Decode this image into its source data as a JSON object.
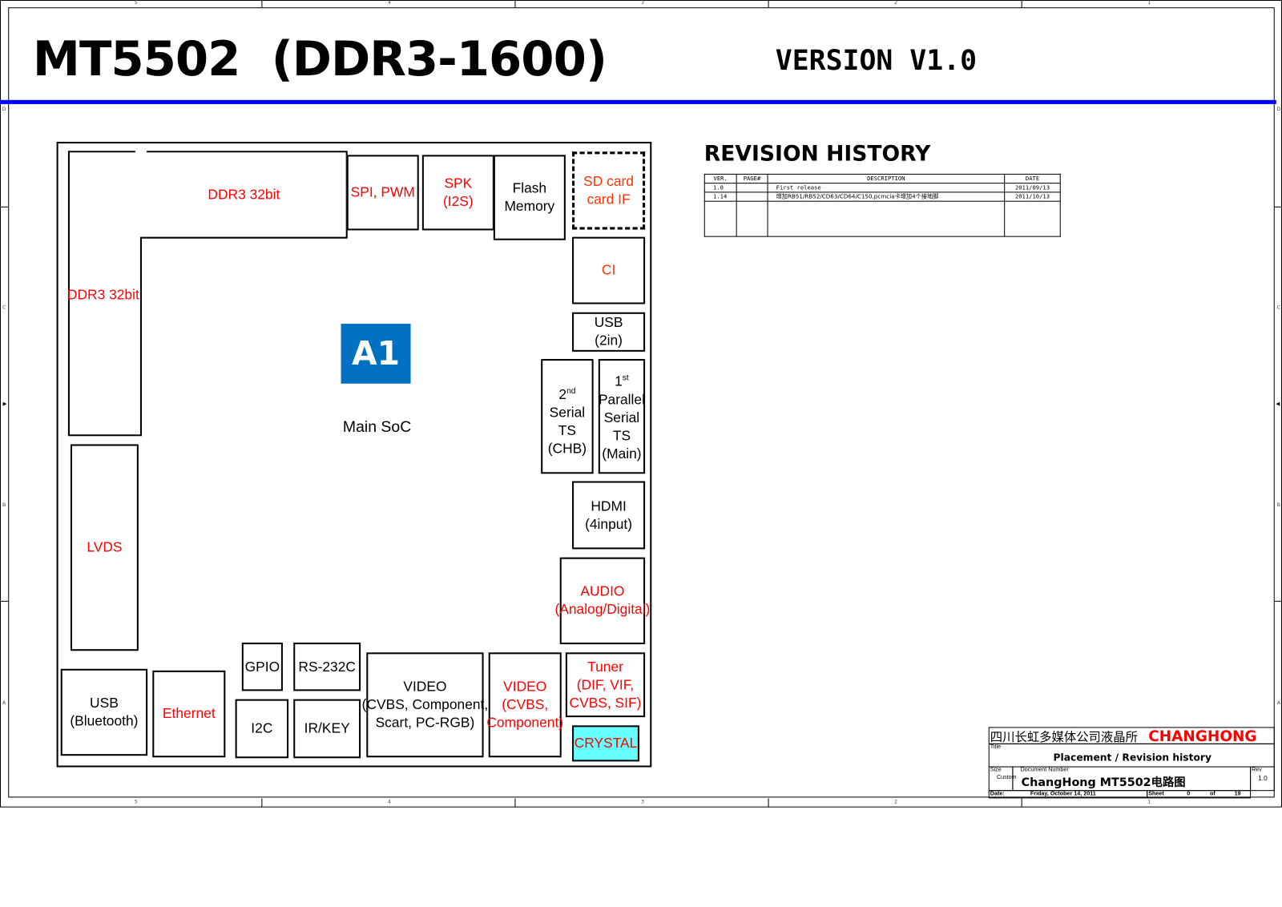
{
  "header": {
    "title": "MT5502  (DDR3-1600)",
    "version": "VERSION V1.0",
    "accent_color": "#0000ff"
  },
  "zones": {
    "columns": [
      "5",
      "4",
      "3",
      "2",
      "1"
    ],
    "rows": [
      "D",
      "C",
      "B",
      "A"
    ]
  },
  "block_diagram": {
    "soc_badge": "A1",
    "soc_badge_color": "#0070c0",
    "soc_label": "Main SoC",
    "blocks": {
      "ddr3_top": "DDR3 32bit",
      "ddr3_left": "DDR3 32bit",
      "spi_pwm": "SPI, PWM",
      "spk_line1": "SPK",
      "spk_line2": "(I2S)",
      "flash_line1": "Flash",
      "flash_line2": "Memory",
      "sdcard_line1": "SD card",
      "sdcard_line2": "card IF",
      "ci": "CI",
      "usb2_line1": "USB",
      "usb2_line2": "(2in)",
      "ts2_line1": "2",
      "ts2_sup": "nd",
      "ts2_line2": "Serial",
      "ts2_line3": "TS",
      "ts2_line4": "(CHB)",
      "ts1_line1": "1",
      "ts1_sup": "st",
      "ts1_line2": "Parallel",
      "ts1_line3": "Serial",
      "ts1_line4": "TS",
      "ts1_line5": "(Main)",
      "hdmi_line1": "HDMI",
      "hdmi_line2": "(4input)",
      "audio_line1": "AUDIO",
      "audio_line2": "(Analog/Digital)",
      "lvds": "LVDS",
      "usb_bt_line1": "USB",
      "usb_bt_line2": "(Bluetooth)",
      "ethernet": "Ethernet",
      "gpio": "GPIO",
      "rs232c": "RS-232C",
      "i2c": "I2C",
      "irkey": "IR/KEY",
      "video1_line1": "VIDEO",
      "video1_line2": "(CVBS, Component,",
      "video1_line3": "Scart, PC-RGB)",
      "video2_line1": "VIDEO",
      "video2_line2": "(CVBS,",
      "video2_line3": "Component)",
      "tuner_line1": "Tuner",
      "tuner_line2": "(DIF, VIF,",
      "tuner_line3": "CVBS, SIF)",
      "crystal": "CRYSTAL",
      "crystal_fill": "#66ffff"
    }
  },
  "revision_history": {
    "title": "REVISION HISTORY",
    "columns": [
      "VER.",
      "PAGE#",
      "DESCRIPTION",
      "DATE"
    ],
    "rows": [
      {
        "ver": "1.0",
        "page": "",
        "description": "First release",
        "date": "2011/09/13"
      },
      {
        "ver": "1.14",
        "page": "",
        "description": "增加RB51/RB52/CD63/CD64/C150,pcmcia卡增加4个接地脚",
        "date": "2011/10/13"
      }
    ]
  },
  "title_block": {
    "company": "四川长虹多媒体公司液晶所",
    "brand": "CHANGHONG",
    "title_label": "Title",
    "title": "Placement / Revision history",
    "size_label": "Size",
    "size": "Custom",
    "docnum_label": "Document Number",
    "docnum": "ChangHong MT5502电路图",
    "rev_label": "Rev",
    "rev": "1.0",
    "date_label": "Date:",
    "date": "Friday, October 14, 2011",
    "sheet_label": "Sheet",
    "sheet": "0",
    "of_label": "of",
    "total": "19"
  }
}
